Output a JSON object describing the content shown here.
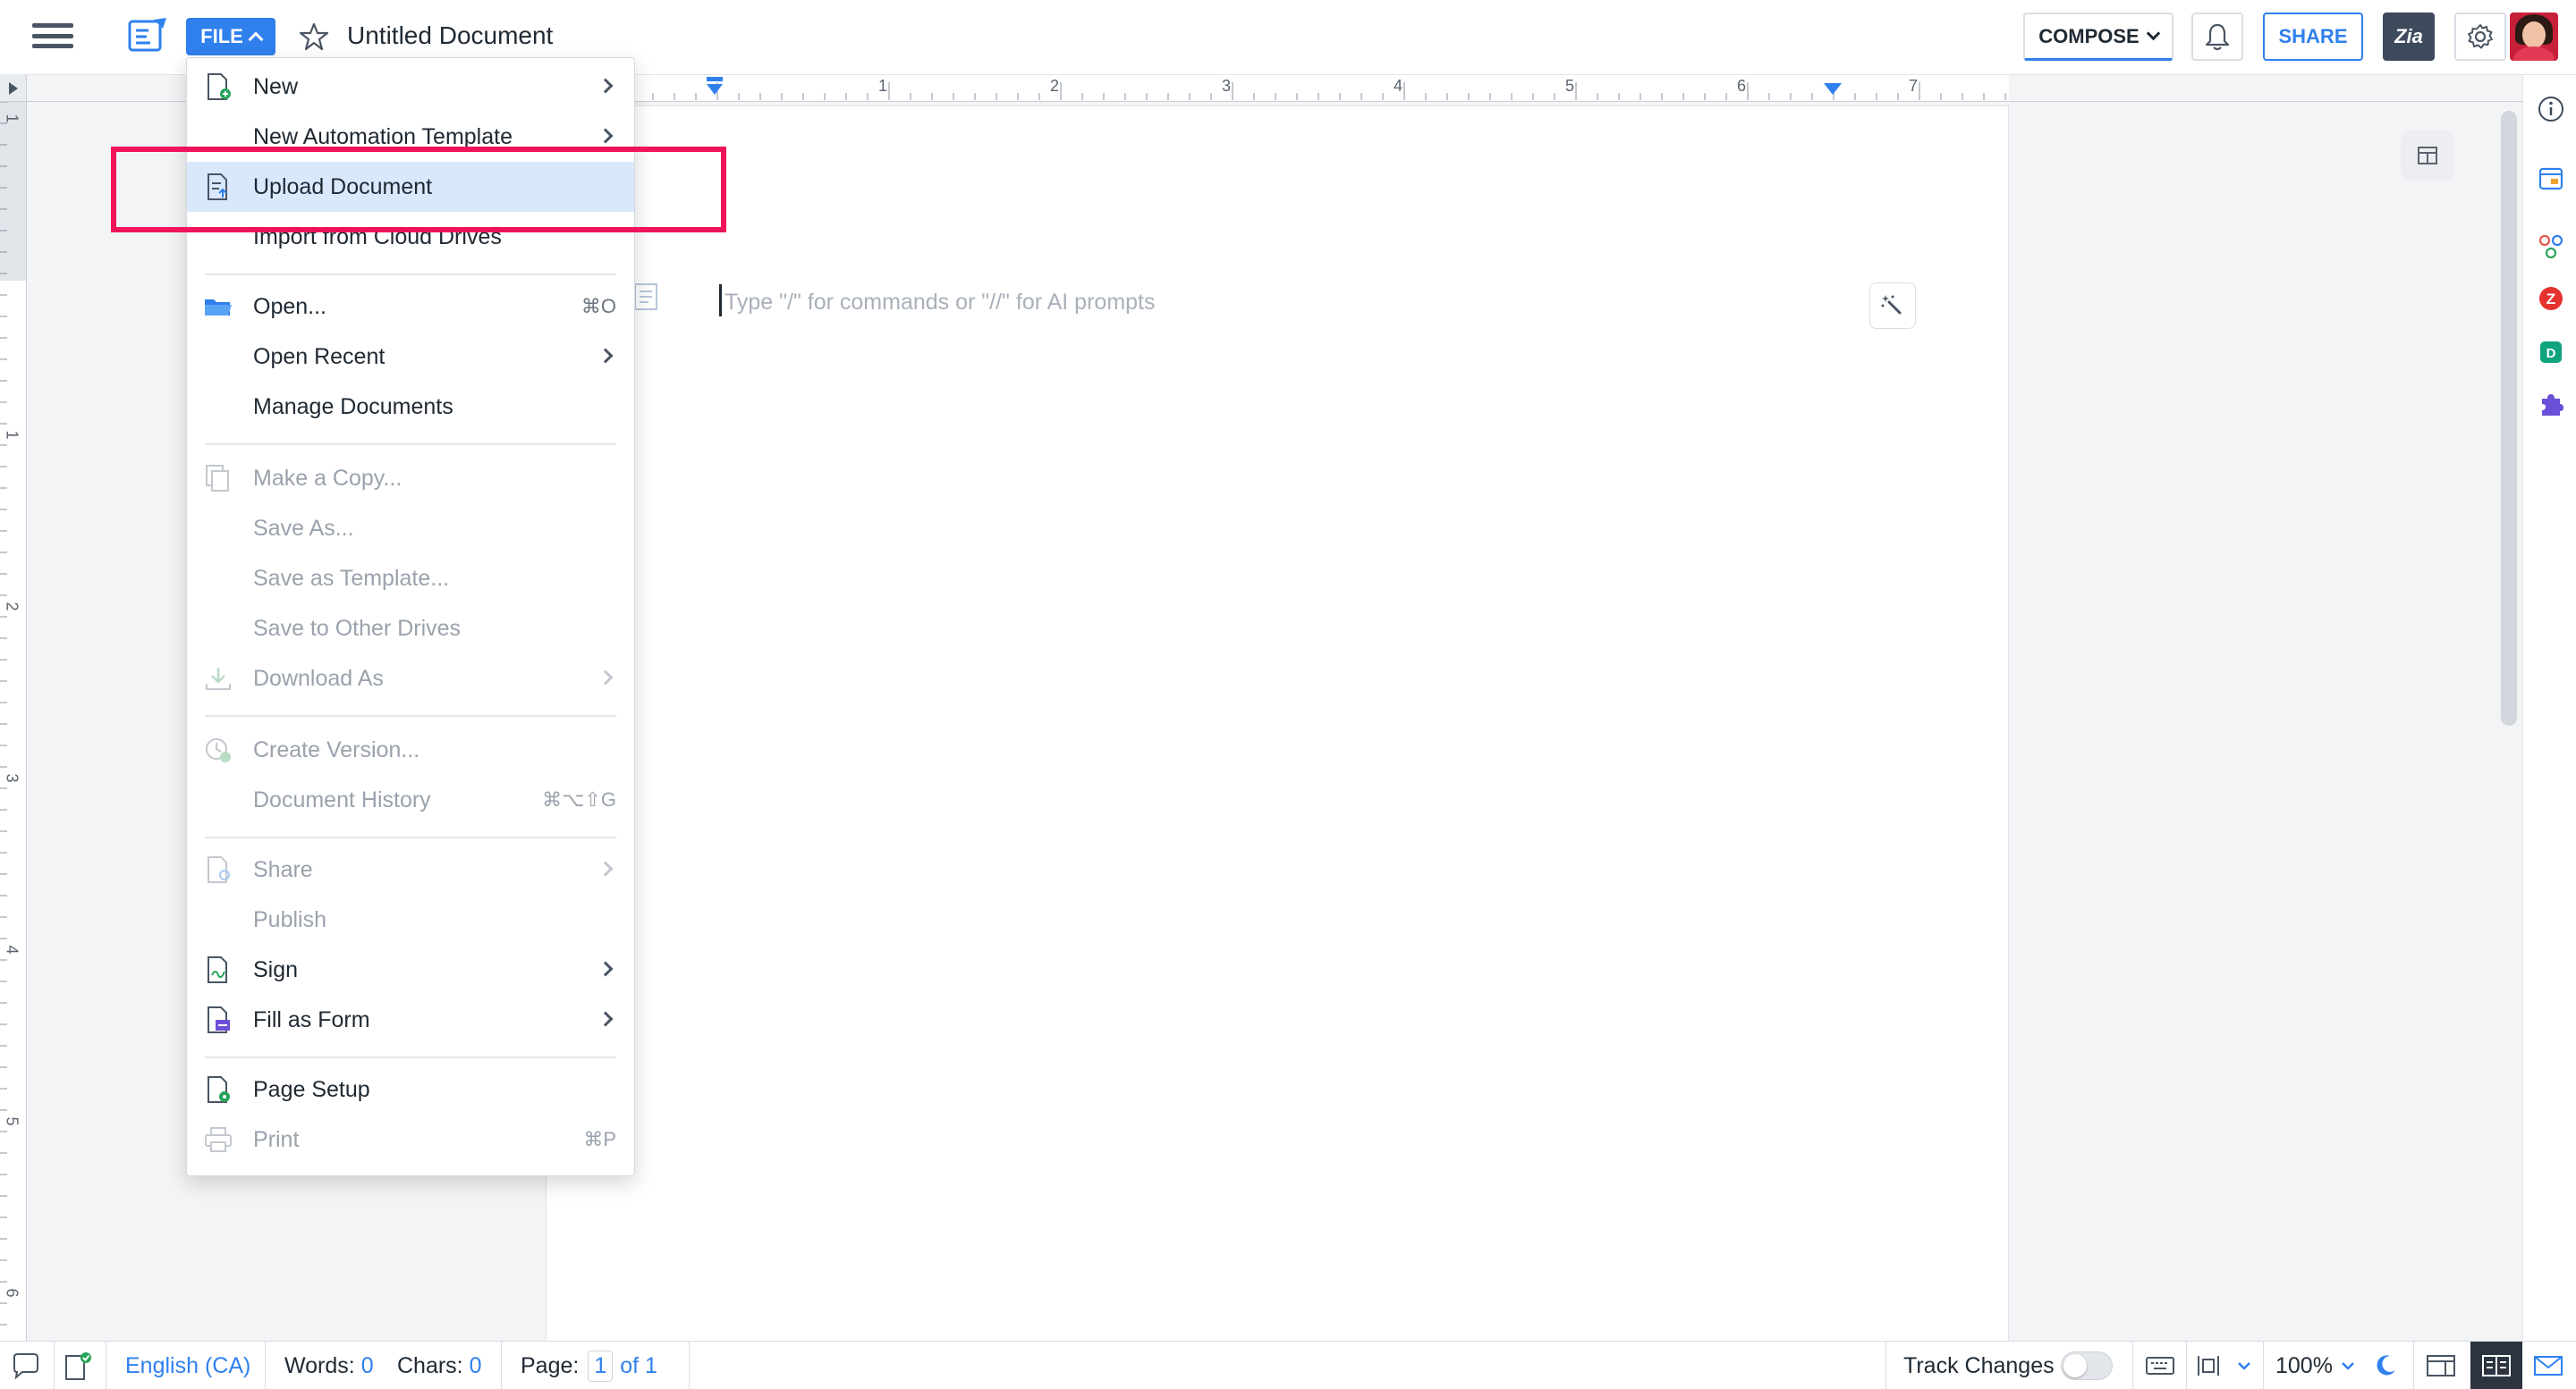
{
  "topbar": {
    "file_label": "FILE",
    "doc_title": "Untitled Document",
    "compose_label": "COMPOSE",
    "share_label": "SHARE",
    "zia_label": "Zia"
  },
  "ruler": {
    "h_numbers": [
      "1",
      "2",
      "3",
      "4",
      "5",
      "6",
      "7"
    ],
    "v_numbers": [
      "1",
      "1",
      "2",
      "3",
      "4",
      "5",
      "6"
    ]
  },
  "editor": {
    "placeholder": "Type \"/\" for commands or \"//\" for AI prompts"
  },
  "file_menu": {
    "items": [
      {
        "label": "New",
        "shortcut": "",
        "arrow": true,
        "disabled": false,
        "icon": "new-doc-icon"
      },
      {
        "label": "New Automation Template",
        "shortcut": "",
        "arrow": true,
        "disabled": false,
        "icon": ""
      },
      {
        "label": "Upload Document",
        "shortcut": "",
        "arrow": false,
        "disabled": false,
        "icon": "upload-doc-icon"
      },
      {
        "label": "Import from Cloud Drives",
        "shortcut": "",
        "arrow": false,
        "disabled": false,
        "icon": ""
      },
      {
        "label": "Open...",
        "shortcut": "⌘O",
        "arrow": false,
        "disabled": false,
        "icon": "folder-icon"
      },
      {
        "label": "Open Recent",
        "shortcut": "",
        "arrow": true,
        "disabled": false,
        "icon": ""
      },
      {
        "label": "Manage Documents",
        "shortcut": "",
        "arrow": false,
        "disabled": false,
        "icon": ""
      },
      {
        "label": "Make a Copy...",
        "shortcut": "",
        "arrow": false,
        "disabled": true,
        "icon": "copy-icon"
      },
      {
        "label": "Save As...",
        "shortcut": "",
        "arrow": false,
        "disabled": true,
        "icon": ""
      },
      {
        "label": "Save as Template...",
        "shortcut": "",
        "arrow": false,
        "disabled": true,
        "icon": ""
      },
      {
        "label": "Save to Other Drives",
        "shortcut": "",
        "arrow": false,
        "disabled": true,
        "icon": ""
      },
      {
        "label": "Download As",
        "shortcut": "",
        "arrow": true,
        "disabled": true,
        "icon": "download-icon"
      },
      {
        "label": "Create Version...",
        "shortcut": "",
        "arrow": false,
        "disabled": true,
        "icon": "version-icon"
      },
      {
        "label": "Document History",
        "shortcut": "⌘⌥⇧G",
        "arrow": false,
        "disabled": true,
        "icon": ""
      },
      {
        "label": "Share",
        "shortcut": "",
        "arrow": true,
        "disabled": true,
        "icon": "share-doc-icon"
      },
      {
        "label": "Publish",
        "shortcut": "",
        "arrow": false,
        "disabled": true,
        "icon": ""
      },
      {
        "label": "Sign",
        "shortcut": "",
        "arrow": true,
        "disabled": false,
        "icon": "sign-icon"
      },
      {
        "label": "Fill as Form",
        "shortcut": "",
        "arrow": true,
        "disabled": false,
        "icon": "form-icon"
      },
      {
        "label": "Page Setup",
        "shortcut": "",
        "arrow": false,
        "disabled": false,
        "icon": "page-setup-icon"
      },
      {
        "label": "Print",
        "shortcut": "⌘P",
        "arrow": false,
        "disabled": true,
        "icon": "print-icon"
      }
    ],
    "highlighted": "Upload Document"
  },
  "statusbar": {
    "language": "English (CA)",
    "words_label": "Words:",
    "words_value": "0",
    "chars_label": "Chars:",
    "chars_value": "0",
    "page_label": "Page:",
    "page_value": "1",
    "page_total": "of 1",
    "track_changes_label": "Track Changes",
    "zoom": "100%"
  },
  "colors": {
    "accent": "#2f80ed",
    "annotation": "#f0145a",
    "highlight": "#d9e9fb"
  }
}
